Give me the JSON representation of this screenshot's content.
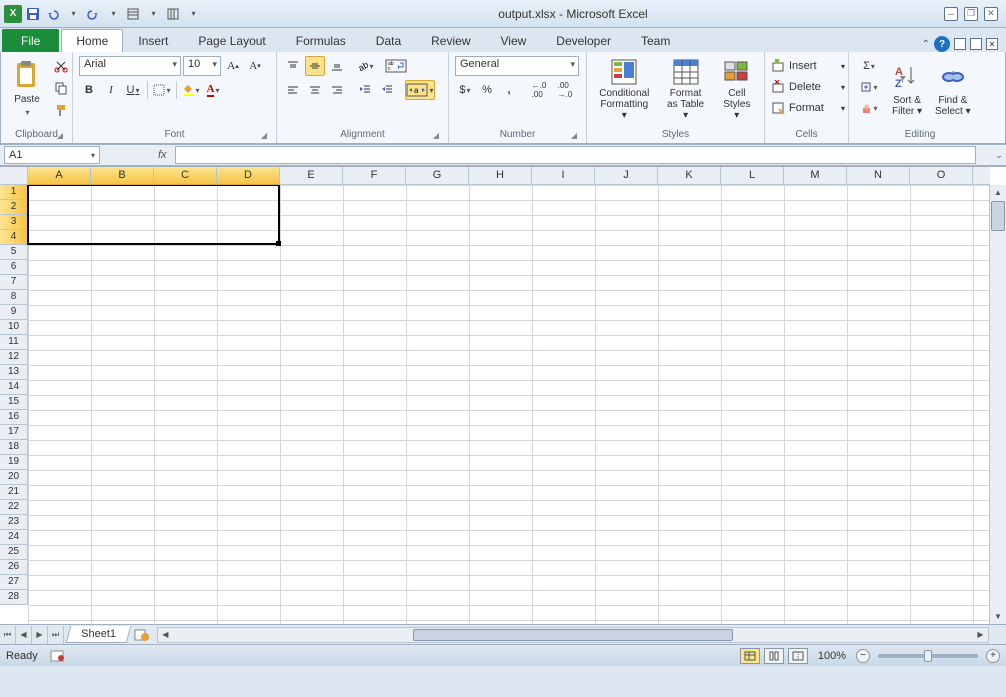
{
  "titlebar": {
    "title": "output.xlsx - Microsoft Excel"
  },
  "tabs": {
    "file": "File",
    "items": [
      "Home",
      "Insert",
      "Page Layout",
      "Formulas",
      "Data",
      "Review",
      "View",
      "Developer",
      "Team"
    ],
    "active": "Home"
  },
  "ribbon": {
    "clipboard": {
      "label": "Clipboard",
      "paste": "Paste"
    },
    "font": {
      "label": "Font",
      "name": "Arial",
      "size": "10",
      "bold": "B",
      "italic": "I",
      "underline": "U"
    },
    "alignment": {
      "label": "Alignment"
    },
    "number": {
      "label": "Number",
      "format": "General",
      "currency": "$",
      "percent": "%",
      "comma": ",",
      "incdec": "←.0",
      "decdec": ".00"
    },
    "styles": {
      "label": "Styles",
      "cond": "Conditional Formatting",
      "table": "Format as Table",
      "cell": "Cell Styles"
    },
    "cells": {
      "label": "Cells",
      "insert": "Insert",
      "delete": "Delete",
      "format": "Format"
    },
    "editing": {
      "label": "Editing",
      "sort": "Sort & Filter",
      "find": "Find & Select",
      "sum": "Σ"
    }
  },
  "formula": {
    "name": "A1",
    "fx": "fx",
    "value": ""
  },
  "grid": {
    "columns": [
      "A",
      "B",
      "C",
      "D",
      "E",
      "F",
      "G",
      "H",
      "I",
      "J",
      "K",
      "L",
      "M",
      "N",
      "O"
    ],
    "selectedCols": [
      "A",
      "B",
      "C",
      "D"
    ],
    "rows": 28,
    "selectedRows": [
      1,
      2,
      3,
      4
    ]
  },
  "sheets": {
    "active": "Sheet1"
  },
  "status": {
    "ready": "Ready",
    "zoom": "100%"
  }
}
